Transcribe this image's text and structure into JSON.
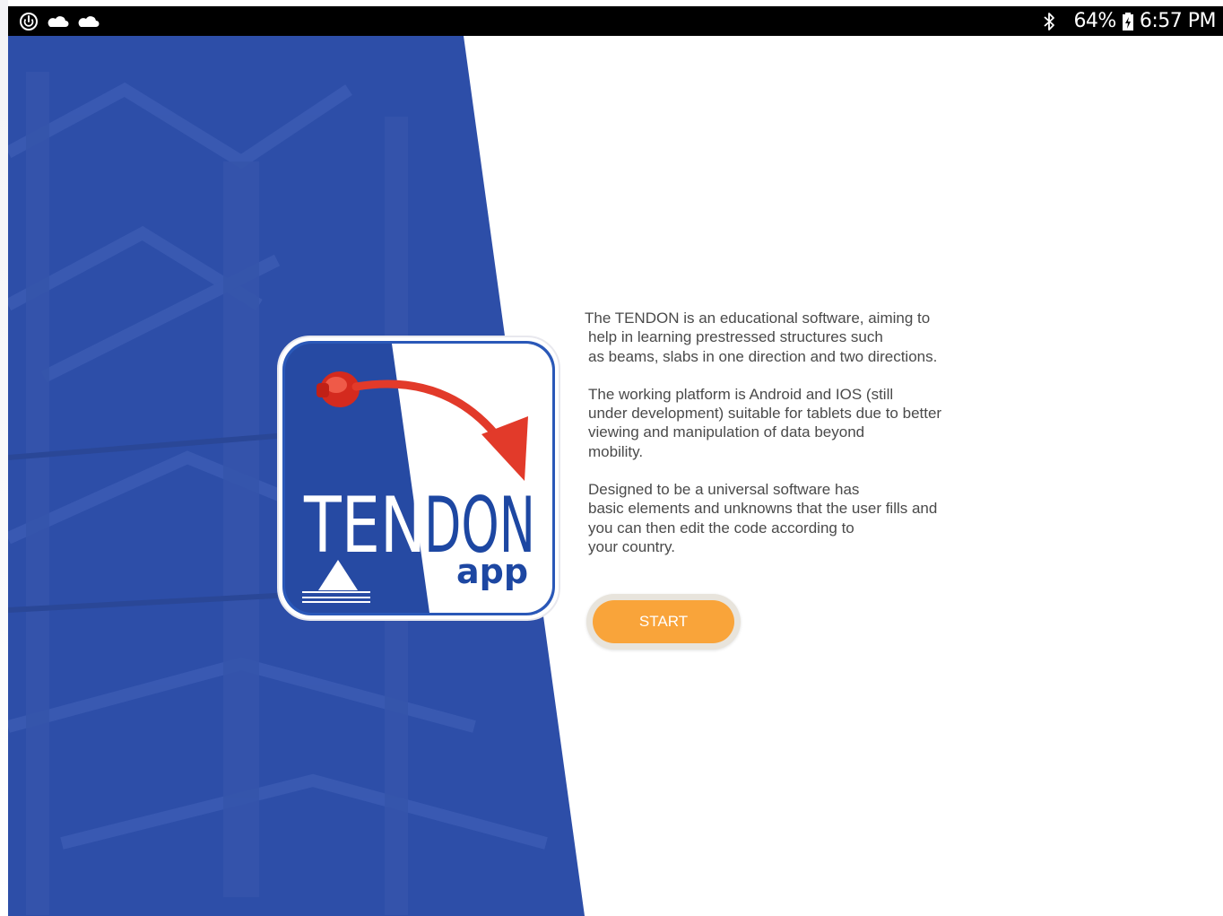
{
  "status_bar": {
    "left_icons": [
      "power-saving-icon",
      "cloud-icon",
      "cloud-icon"
    ],
    "bluetooth_icon": "bluetooth-icon",
    "battery_percent": "64%",
    "battery_icon": "battery-charging-icon",
    "time": "6:57 PM"
  },
  "logo": {
    "title": "TENDON",
    "subtitle": "app",
    "icon": "tendon-anchor-arrow-icon"
  },
  "description": {
    "paragraphs": [
      {
        "lines": [
          "The TENDON is an educational software, aiming to",
          "help in learning prestressed structures such",
          "as beams, slabs in one direction and two directions."
        ]
      },
      {
        "lines": [
          "The working platform is Android and IOS (still",
          "under development) suitable for tablets due to better",
          "viewing and manipulation of data beyond",
          "mobility."
        ]
      },
      {
        "lines": [
          "Designed to be a universal software has",
          "basic elements and unknowns that the user fills and",
          "you can then edit the code according to",
          "your country."
        ]
      }
    ]
  },
  "start_button": {
    "label": "START"
  },
  "colors": {
    "hero_blue": "#2d4ea8",
    "button_orange": "#f9a43a",
    "logo_red": "#e23a2a",
    "status_bar": "#000000"
  }
}
